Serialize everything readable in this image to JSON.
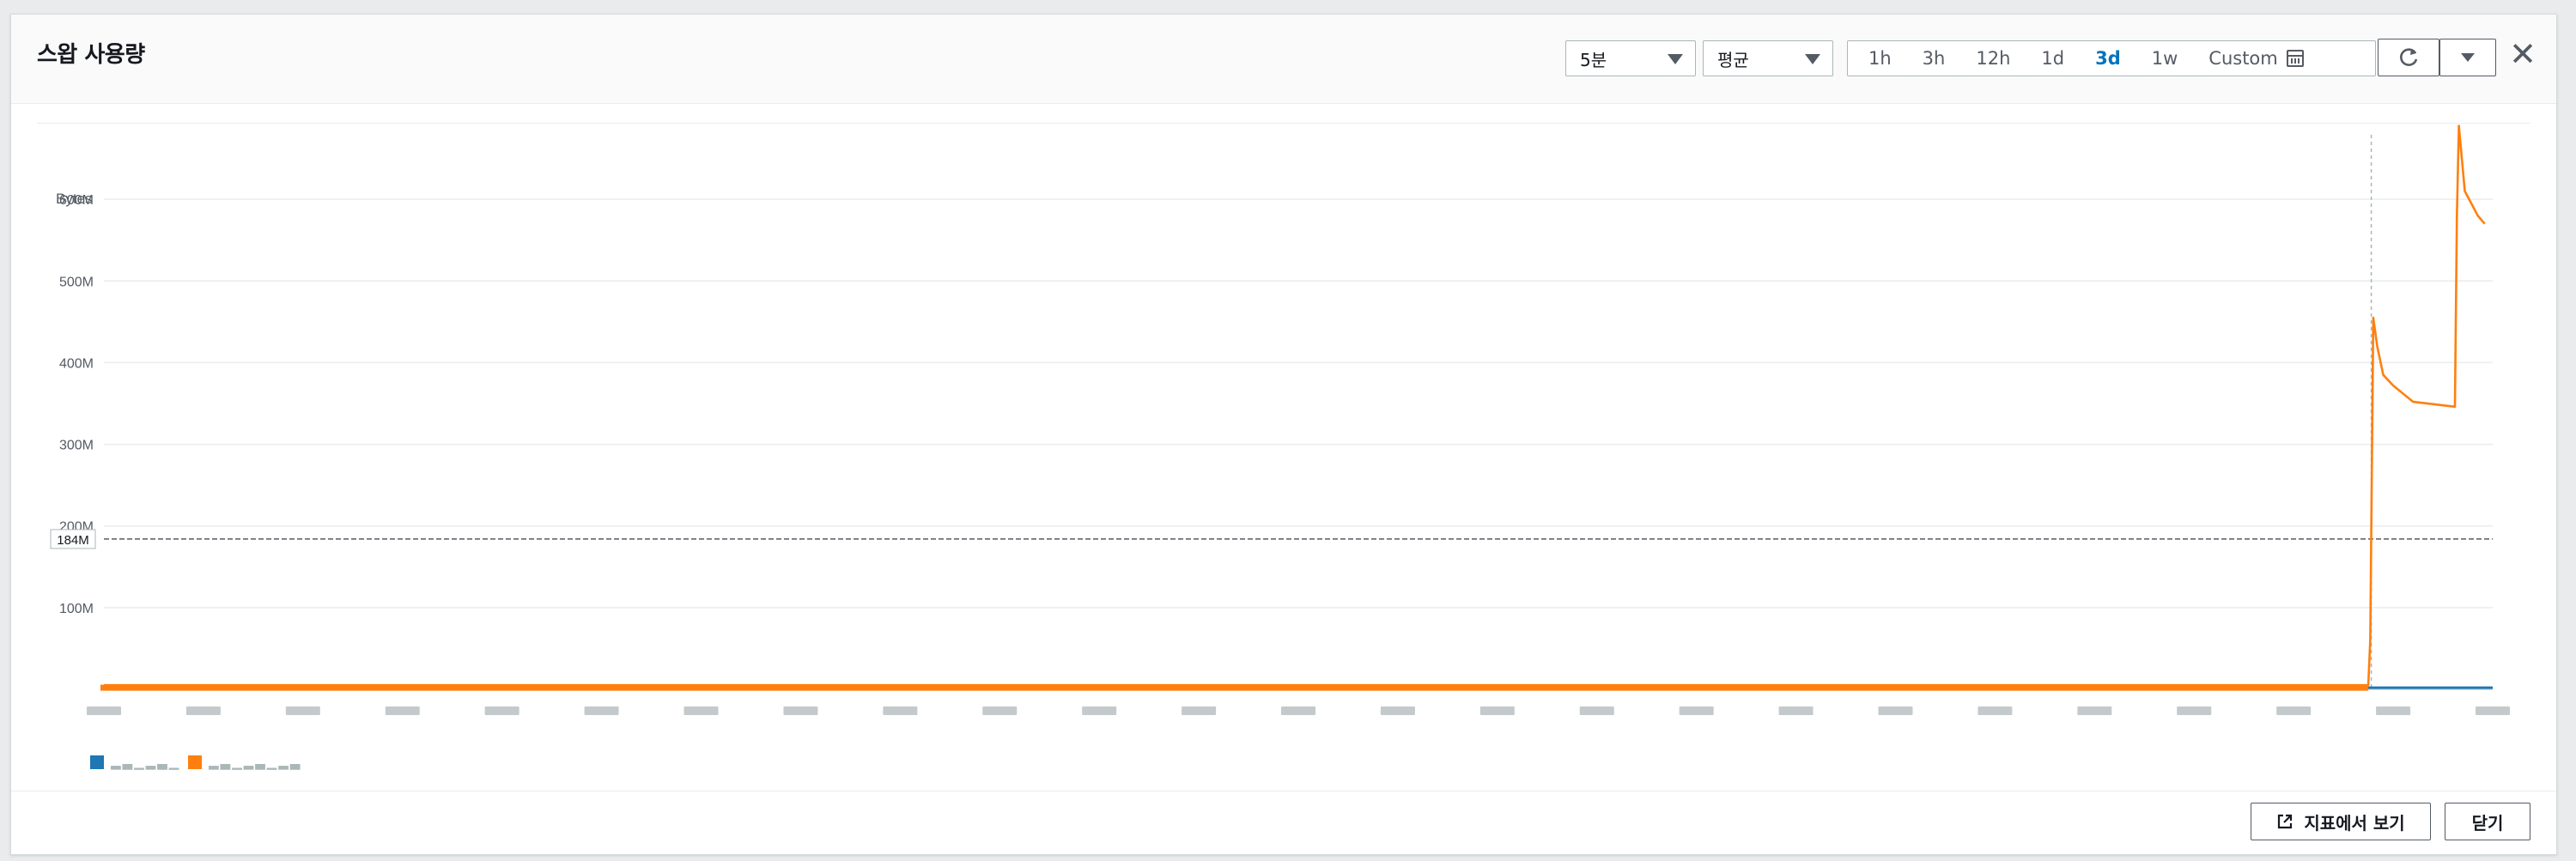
{
  "dialog": {
    "title": "스왑 사용량",
    "period_select": "5분",
    "stat_select": "평균",
    "time_ranges": [
      {
        "label": "1h",
        "active": false
      },
      {
        "label": "3h",
        "active": false
      },
      {
        "label": "12h",
        "active": false
      },
      {
        "label": "1d",
        "active": false
      },
      {
        "label": "3d",
        "active": true
      },
      {
        "label": "1w",
        "active": false
      },
      {
        "label": "Custom",
        "active": false
      }
    ],
    "footer": {
      "view_in_metrics": "지표에서 보기",
      "close": "닫기"
    }
  },
  "colors": {
    "series_blue": "#1f77b4",
    "series_orange": "#ff7f0e",
    "active_link": "#0073bb"
  },
  "icons": [
    "chevron-down-icon",
    "calendar-icon",
    "refresh-icon",
    "close-icon",
    "external-link-icon"
  ],
  "chart_data": {
    "type": "line",
    "ylabel": "Bytes",
    "y_ticks": [
      "100M",
      "200M",
      "300M",
      "400M",
      "500M",
      "600M"
    ],
    "ylim": [
      0,
      700
    ],
    "y_unit": "M",
    "threshold": {
      "value": 184,
      "label": "184M"
    },
    "x_count": 25,
    "grid": true,
    "legend_position": "bottom-left",
    "series": [
      {
        "color": "#1f77b4",
        "points": [
          [
            0,
            2
          ],
          [
            24,
            2
          ]
        ]
      },
      {
        "color": "#ff7f0e",
        "points": [
          [
            0,
            5
          ],
          [
            22.75,
            5
          ],
          [
            22.77,
            60
          ],
          [
            22.8,
            455
          ],
          [
            22.84,
            420
          ],
          [
            22.9,
            385
          ],
          [
            23.0,
            372
          ],
          [
            23.2,
            352
          ],
          [
            23.62,
            346
          ],
          [
            23.64,
            580
          ],
          [
            23.66,
            690
          ],
          [
            23.72,
            610
          ],
          [
            23.85,
            580
          ],
          [
            23.92,
            570
          ]
        ]
      }
    ]
  }
}
